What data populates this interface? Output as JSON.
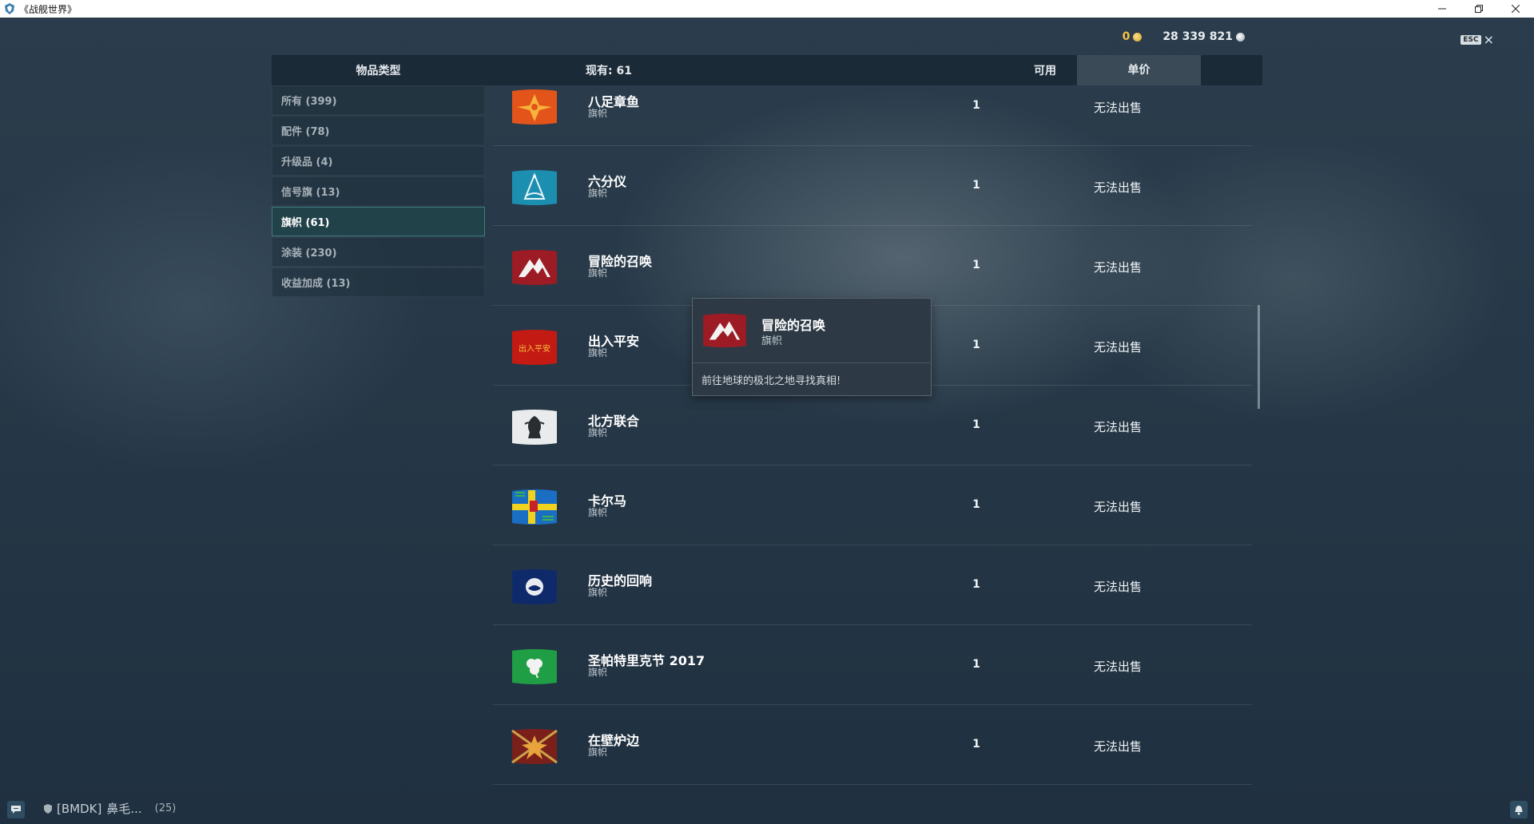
{
  "window": {
    "title": "《战舰世界》"
  },
  "currency": {
    "gold": "0",
    "credits": "28 339 821"
  },
  "esc": {
    "key": "ESC",
    "close": "×"
  },
  "header": {
    "category": "物品类型",
    "count": "现有:  61",
    "available": "可用",
    "price": "单价"
  },
  "sidebar": {
    "items": [
      {
        "label": "所有 (399)"
      },
      {
        "label": "配件 (78)"
      },
      {
        "label": "升级品 (4)"
      },
      {
        "label": "信号旗 (13)"
      },
      {
        "label": "旗帜 (61)"
      },
      {
        "label": "涂装 (230)"
      },
      {
        "label": "收益加成 (13)"
      }
    ],
    "active_index": 4
  },
  "rows": [
    {
      "name": "八足章鱼",
      "type": "旗帜",
      "available": "1",
      "price": "无法出售"
    },
    {
      "name": "六分仪",
      "type": "旗帜",
      "available": "1",
      "price": "无法出售"
    },
    {
      "name": "冒险的召唤",
      "type": "旗帜",
      "available": "1",
      "price": "无法出售"
    },
    {
      "name": "出入平安",
      "type": "旗帜",
      "available": "1",
      "price": "无法出售"
    },
    {
      "name": "北方联合",
      "type": "旗帜",
      "available": "1",
      "price": "无法出售"
    },
    {
      "name": "卡尔马",
      "type": "旗帜",
      "available": "1",
      "price": "无法出售"
    },
    {
      "name": "历史的回响",
      "type": "旗帜",
      "available": "1",
      "price": "无法出售"
    },
    {
      "name": "圣帕特里克节 2017",
      "type": "旗帜",
      "available": "1",
      "price": "无法出售"
    },
    {
      "name": "在壁炉边",
      "type": "旗帜",
      "available": "1",
      "price": "无法出售"
    },
    {
      "name": "...",
      "type": "",
      "available": "",
      "price": ""
    }
  ],
  "tooltip": {
    "name": "冒险的召唤",
    "type": "旗帜",
    "description": "前往地球的极北之地寻找真相!"
  },
  "bottom": {
    "clan_tag": "[BMDK]",
    "player": "鼻毛...",
    "count": "(25)"
  },
  "colors": {
    "accent_active": "#22424a",
    "gold": "#f5c242"
  },
  "icons": [
    "app-icon",
    "gold-coin-icon",
    "credits-icon",
    "close-icon",
    "chat-icon",
    "clan-shield-icon",
    "bell-icon"
  ]
}
